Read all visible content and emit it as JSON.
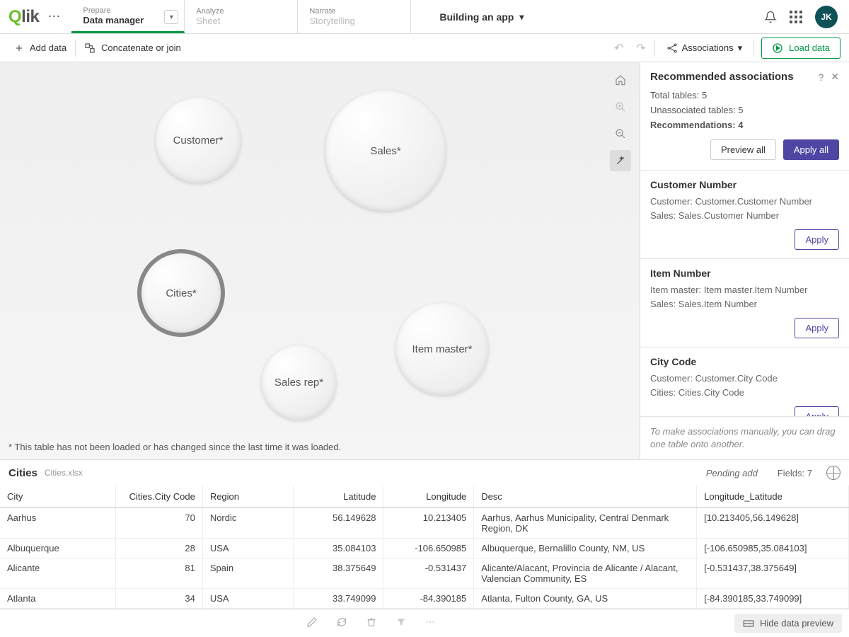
{
  "logo": "Qlik",
  "nav": {
    "prepare": {
      "top": "Prepare",
      "bottom": "Data manager"
    },
    "analyze": {
      "top": "Analyze",
      "bottom": "Sheet"
    },
    "narrate": {
      "top": "Narrate",
      "bottom": "Storytelling"
    }
  },
  "app_name": "Building an app",
  "avatar": "JK",
  "toolbar": {
    "add_data": "Add data",
    "concat": "Concatenate or join",
    "associations": "Associations",
    "load": "Load data"
  },
  "bubbles": {
    "customer": "Customer*",
    "sales": "Sales*",
    "cities": "Cities*",
    "item_master": "Item master*",
    "sales_rep": "Sales rep*"
  },
  "footnote": "* This table has not been loaded or has changed since the last time it was loaded.",
  "panel": {
    "title": "Recommended associations",
    "total_tables_label": "Total tables: ",
    "total_tables_val": "5",
    "unassoc_label": "Unassociated tables: ",
    "unassoc_val": "5",
    "rec_label": "Recommendations: ",
    "rec_val": "4",
    "preview_all": "Preview all",
    "apply_all": "Apply all",
    "apply": "Apply",
    "hint": "To make associations manually, you can drag one table onto another.",
    "recs": [
      {
        "title": "Customer Number",
        "l1": "Customer: Customer.Customer Number",
        "l2": "Sales: Sales.Customer Number"
      },
      {
        "title": "Item Number",
        "l1": "Item master: Item master.Item Number",
        "l2": "Sales: Sales.Item Number"
      },
      {
        "title": "City Code",
        "l1": "Customer: Customer.City Code",
        "l2": "Cities: Cities.City Code"
      }
    ]
  },
  "preview": {
    "table": "Cities",
    "file": "Cities.xlsx",
    "status": "Pending add",
    "fields_label": "Fields: ",
    "fields_count": "7",
    "columns": [
      "City",
      "Cities.City Code",
      "Region",
      "Latitude",
      "Longitude",
      "Desc",
      "Longitude_Latitude"
    ],
    "rows": [
      [
        "Aarhus",
        "70",
        "Nordic",
        "56.149628",
        "10.213405",
        "Aarhus, Aarhus Municipality, Central Denmark Region, DK",
        "[10.213405,56.149628]"
      ],
      [
        "Albuquerque",
        "28",
        "USA",
        "35.084103",
        "-106.650985",
        "Albuquerque, Bernalillo County, NM, US",
        "[-106.650985,35.084103]"
      ],
      [
        "Alicante",
        "81",
        "Spain",
        "38.375649",
        "-0.531437",
        "Alicante/Alacant, Provincia de Alicante / Alacant, Valencian Community, ES",
        "[-0.531437,38.375649]"
      ],
      [
        "Atlanta",
        "34",
        "USA",
        "33.749099",
        "-84.390185",
        "Atlanta, Fulton County, GA, US",
        "[-84.390185,33.749099]"
      ]
    ]
  },
  "bottom": {
    "hide": "Hide data preview"
  }
}
